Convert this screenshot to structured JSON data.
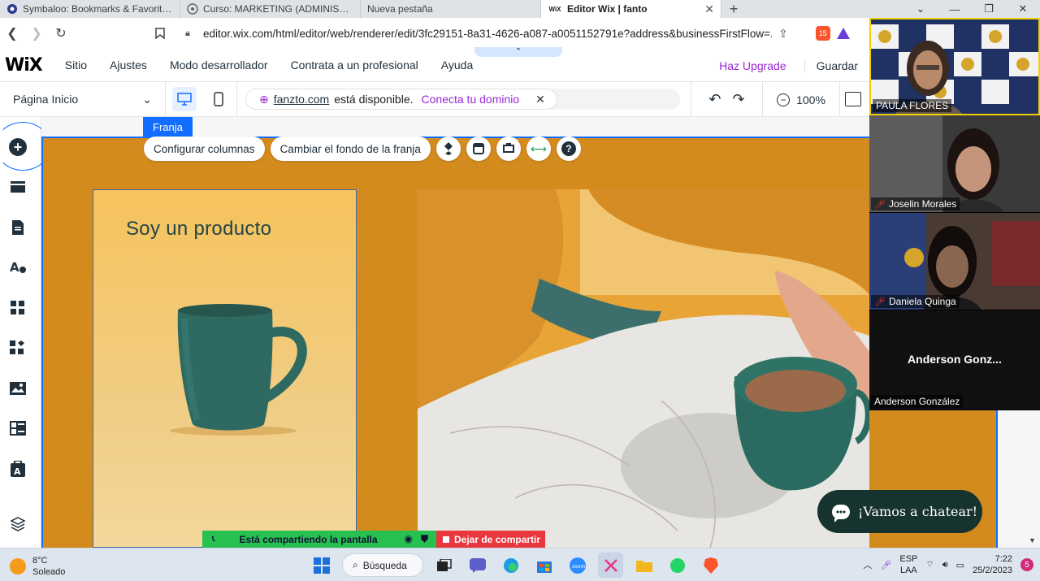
{
  "browser": {
    "tabs": [
      {
        "title": "Symbaloo: Bookmarks & Favorites - Th",
        "icon": "symbaloo-icon"
      },
      {
        "title": "Curso: MARKETING (ADMINISTRACIÓN",
        "icon": "moodle-icon"
      },
      {
        "title": "Nueva pestaña",
        "icon": "newtab-icon"
      },
      {
        "title": "Editor Wix | fanto",
        "icon": "wix-icon",
        "favicon_text": "WiX",
        "active": true
      }
    ],
    "new_tab": "+",
    "url": "editor.wix.com/html/editor/web/renderer/edit/3fc29151-8a31-4626-a087-a0051152791e?address&businessFirstFlow=...",
    "shield_badge": "15"
  },
  "wix": {
    "logo": "WiX",
    "menu": [
      "Sitio",
      "Ajustes",
      "Modo desarrollador",
      "Contrata a un profesional",
      "Ayuda"
    ],
    "upgrade": "Haz Upgrade",
    "save": "Guardar",
    "page_selector": "Página Inicio",
    "domain": {
      "name": "fanzto.com",
      "message": "está disponible.",
      "cta": "Conecta tu dominio"
    },
    "zoom": "100%"
  },
  "canvas": {
    "strip_label": "Franja",
    "toolbar": {
      "configure": "Configurar columnas",
      "background": "Cambiar el fondo de la franja"
    },
    "product_title": "Soy un producto",
    "chat_label": "¡Vamos a chatear!"
  },
  "zoom_call": {
    "participants": [
      {
        "name": "PAULA FLORES",
        "muted": false
      },
      {
        "name": "Joselin Morales",
        "muted": true
      },
      {
        "name": "Daniela Quinga",
        "muted": true
      },
      {
        "name": "Anderson González",
        "display": "Anderson  Gonz...",
        "muted": false
      }
    ]
  },
  "share_bar": {
    "status": "Está compartiendo la pantalla",
    "stop": "Dejar de compartir"
  },
  "taskbar": {
    "weather_temp": "8°C",
    "weather_desc": "Soleado",
    "search": "Búsqueda",
    "lang": "ESP",
    "layout": "LAA",
    "time": "7:22",
    "date": "25/2/2023",
    "notifications": "5"
  },
  "colors": {
    "strip_bg": "#d48b1e",
    "wix_blue": "#116dff",
    "upgrade_purple": "#9a27d5",
    "product_title": "#214349",
    "chat_bg": "#17332f"
  }
}
